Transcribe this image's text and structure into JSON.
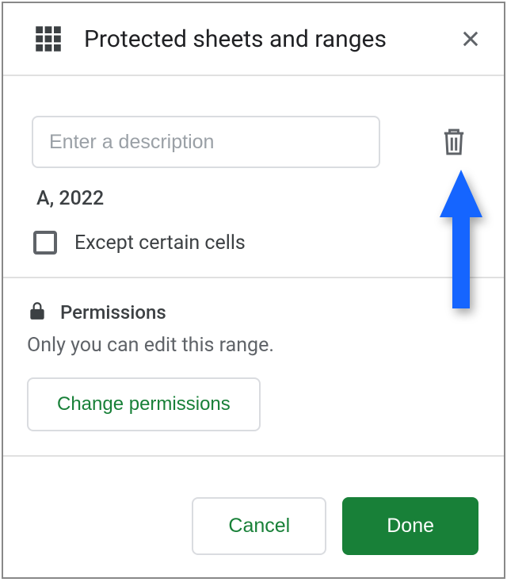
{
  "header": {
    "title": "Protected sheets and ranges"
  },
  "description": {
    "placeholder": "Enter a description",
    "value": ""
  },
  "range_label": "A, 2022",
  "except_cells_label": "Except certain cells",
  "permissions": {
    "title": "Permissions",
    "description": "Only you can edit this range.",
    "change_button": "Change permissions"
  },
  "footer": {
    "cancel": "Cancel",
    "done": "Done"
  }
}
